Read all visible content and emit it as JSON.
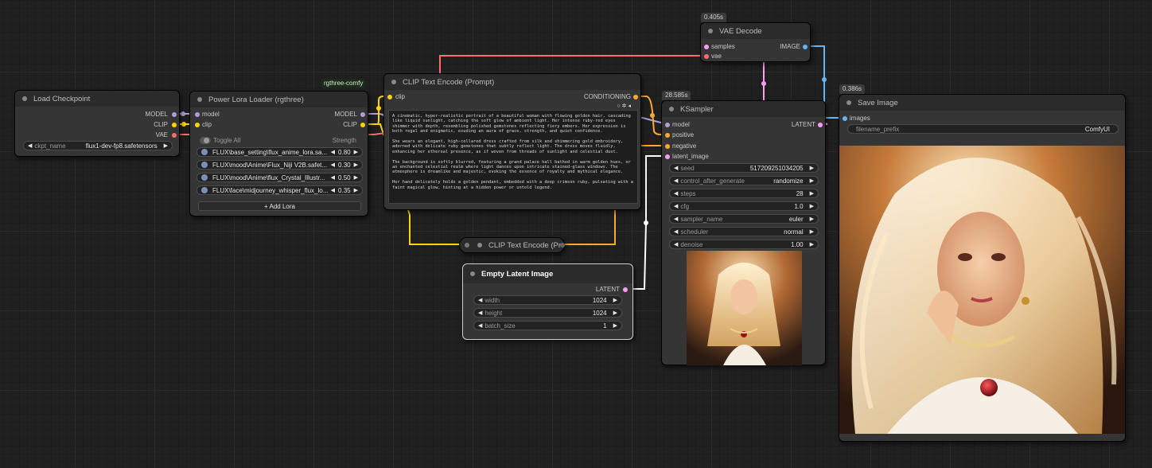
{
  "colors": {
    "model": "#b39ddb",
    "clip": "#ffd500",
    "vae": "#ff6e6e",
    "conditioning": "#ffa931",
    "latent": "#ff9cf9",
    "image": "#64b5f6"
  },
  "load_checkpoint": {
    "title": "Load Checkpoint",
    "outputs": [
      "MODEL",
      "CLIP",
      "VAE"
    ],
    "ckpt_label": "ckpt_name",
    "ckpt_value": "flux1-dev-fp8.safetensors"
  },
  "power_lora": {
    "badge": "rgthree-comfy",
    "title": "Power Lora Loader (rgthree)",
    "inputs": [
      "model",
      "clip"
    ],
    "outputs": [
      "MODEL",
      "CLIP"
    ],
    "toggle_all": "Toggle All",
    "strength_label": "Strength",
    "loras": [
      {
        "name": "FLUX\\base_setting\\flux_anime_lora.sa...",
        "strength": "0.80"
      },
      {
        "name": "FLUX\\mood\\Anime\\Flux_Niji V2B.safet...",
        "strength": "0.30"
      },
      {
        "name": "FLUX\\mood\\Anime\\flux_Crystal_Illustr...",
        "strength": "0.50"
      },
      {
        "name": "FLUX\\face\\midjourney_whisper_flux_lo...",
        "strength": "0.35"
      }
    ],
    "add_lora": "+ Add Lora"
  },
  "clip_encode": {
    "title": "CLIP Text Encode (Prompt)",
    "input": "clip",
    "output": "CONDITIONING",
    "prompt": "A cinematic, hyper-realistic portrait of a beautiful woman with flowing golden hair, cascading like liquid sunlight, catching the soft glow of ambient light. Her intense ruby-red eyes shimmer with depth, resembling polished gemstones reflecting fiery embers. Her expression is both regal and enigmatic, exuding an aura of grace, strength, and quiet confidence.\n\nShe wears an elegant, high-collared dress crafted from silk and shimmering gold embroidery, adorned with delicate ruby gemstones that subtly reflect light. The dress moves fluidly, enhancing her ethereal presence, as if woven from threads of sunlight and celestial dust.\n\nThe background is softly blurred, featuring a grand palace hall bathed in warm golden hues, or an enchanted celestial realm where light dances upon intricate stained-glass windows. The atmosphere is dreamlike and majestic, evoking the essence of royalty and mythical elegance.\n\nHer hand delicately holds a golden pendant, embedded with a deep crimson ruby, pulsating with a faint magical glow, hinting at a hidden power or untold legend."
  },
  "clip_encode_collapsed": {
    "title": "CLIP Text Encode (Pr"
  },
  "empty_latent": {
    "title": "Empty Latent Image",
    "output": "LATENT",
    "widgets": [
      {
        "label": "width",
        "value": "1024"
      },
      {
        "label": "height",
        "value": "1024"
      },
      {
        "label": "batch_size",
        "value": "1"
      }
    ]
  },
  "ksampler": {
    "timing": "28.585s",
    "title": "KSampler",
    "inputs": [
      "model",
      "positive",
      "negative",
      "latent_image"
    ],
    "output": "LATENT",
    "widgets": [
      {
        "label": "seed",
        "value": "517209251034205"
      },
      {
        "label": "control_after_generate",
        "value": "randomize"
      },
      {
        "label": "steps",
        "value": "28"
      },
      {
        "label": "cfg",
        "value": "1.0"
      },
      {
        "label": "sampler_name",
        "value": "euler"
      },
      {
        "label": "scheduler",
        "value": "normal"
      },
      {
        "label": "denoise",
        "value": "1.00"
      }
    ]
  },
  "vae_decode": {
    "timing": "0.405s",
    "title": "VAE Decode",
    "inputs": [
      "samples",
      "vae"
    ],
    "output": "IMAGE"
  },
  "save_image": {
    "timing": "0.386s",
    "title": "Save Image",
    "input": "images",
    "prefix_label": "filename_prefix",
    "prefix_value": "ComfyUI"
  }
}
